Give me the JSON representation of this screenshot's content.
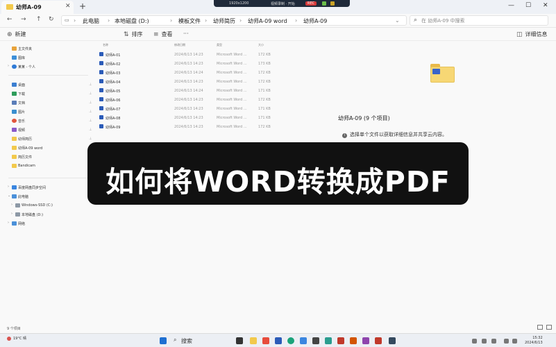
{
  "titlebar": {
    "tab_title": "幼师A-09",
    "tab_close": "✕",
    "tab_add": "+",
    "recorder": {
      "resolution": "1920x1200",
      "label": "视频录制 · 开始",
      "rec": "REC"
    },
    "min": "—",
    "max": "☐",
    "close": "✕"
  },
  "address": {
    "back": "←",
    "forward": "→",
    "up": "↑",
    "refresh": "↻",
    "crumbs": [
      "此电脑",
      "本地磁盘 (D:)",
      "模板文件",
      "幼师简历",
      "幼师A-09 word",
      "幼师A-09"
    ],
    "search_placeholder": "在 幼师A-09 中搜索"
  },
  "toolbar": {
    "new": "新建",
    "sort": "排序",
    "view": "查看",
    "more": "···",
    "details": "详细信息"
  },
  "sidebar": {
    "top": [
      "主文件夹",
      "图库",
      "某某 - 个人"
    ],
    "quick": [
      "桌面",
      "下载",
      "文档",
      "图片",
      "音乐",
      "视频",
      "幼师简历",
      "幼师A-09 word",
      "简历文件",
      "Bandicam"
    ],
    "bottom": [
      "百度网盘同步空间",
      "此电脑",
      "Windows-SSD (C:)",
      "本地磁盘 (D:)",
      "网络"
    ]
  },
  "filelist": {
    "headers": {
      "name": "名称",
      "date": "修改日期",
      "type": "类型",
      "size": "大小"
    },
    "rows": [
      {
        "name": "幼师A-01",
        "date": "2024/6/13 14:23",
        "type": "Microsoft Word ...",
        "size": "172 KB"
      },
      {
        "name": "幼师A-02",
        "date": "2024/6/13 14:23",
        "type": "Microsoft Word ...",
        "size": "173 KB"
      },
      {
        "name": "幼师A-03",
        "date": "2024/6/13 14:24",
        "type": "Microsoft Word ...",
        "size": "172 KB"
      },
      {
        "name": "幼师A-04",
        "date": "2024/6/13 14:23",
        "type": "Microsoft Word ...",
        "size": "172 KB"
      },
      {
        "name": "幼师A-05",
        "date": "2024/6/13 14:24",
        "type": "Microsoft Word ...",
        "size": "171 KB"
      },
      {
        "name": "幼师A-06",
        "date": "2024/6/13 14:23",
        "type": "Microsoft Word ...",
        "size": "172 KB"
      },
      {
        "name": "幼师A-07",
        "date": "2024/6/13 14:23",
        "type": "Microsoft Word ...",
        "size": "171 KB"
      },
      {
        "name": "幼师A-08",
        "date": "2024/6/13 14:23",
        "type": "Microsoft Word ...",
        "size": "171 KB"
      },
      {
        "name": "幼师A-09",
        "date": "2024/6/13 14:23",
        "type": "Microsoft Word ...",
        "size": "172 KB"
      }
    ]
  },
  "details": {
    "title": "幼师A-09 (9 个项目)",
    "hint": "选择单个文件以获取详细信息并共享云内容。"
  },
  "overlay": {
    "caption": "如何将WORD转换成PDF"
  },
  "status": {
    "count": "9 个项目"
  },
  "taskbar": {
    "weather_temp": "19°C",
    "weather_desc": "晴",
    "search": "搜索",
    "time": "15:32",
    "date": "2024/6/13"
  }
}
